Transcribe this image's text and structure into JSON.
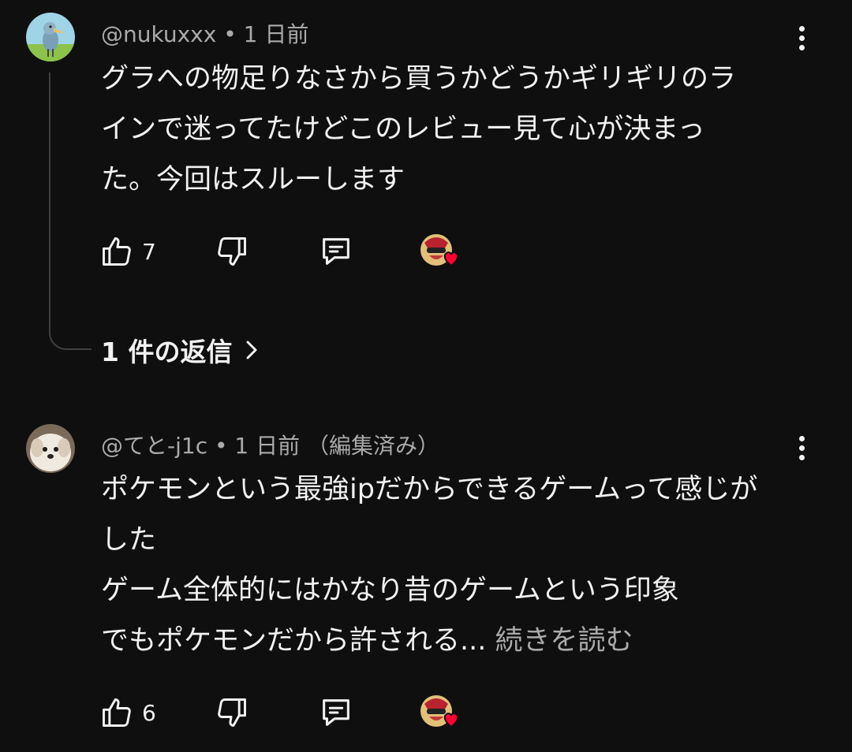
{
  "comments": [
    {
      "handle": "@nukuxxx",
      "time": "1 日前",
      "edited": "",
      "lines": [
        "グラへの物足りなさから買うかどうかギリギリのラ",
        "インで迷ってたけどこのレビュー見て心が決まっ",
        "た。今回はスルーします"
      ],
      "read_more": "",
      "likes": "7",
      "avatar_icon": "shoebill-bird-avatar",
      "replies_label": "1 件の返信"
    },
    {
      "handle": "@てと-j1c",
      "time": "1 日前",
      "edited": "（編集済み）",
      "lines": [
        "ポケモンという最強ipだからできるゲームって感じが",
        "した",
        "ゲーム全体的にはかなり昔のゲームという印象",
        "でもポケモンだから許される... "
      ],
      "read_more": "続きを読む",
      "likes": "6",
      "avatar_icon": "dog-avatar"
    }
  ],
  "icons": {
    "like": "thumbs-up-icon",
    "dislike": "thumbs-down-icon",
    "reply": "reply-comment-icon",
    "creator_heart": "creator-heart-icon",
    "more": "more-vertical-icon",
    "chevron": "chevron-right-icon"
  },
  "colors": {
    "background": "#0f0f0f",
    "text": "#f1f1f1",
    "secondary_text": "#aaaaaa",
    "heart": "#ff0033"
  }
}
